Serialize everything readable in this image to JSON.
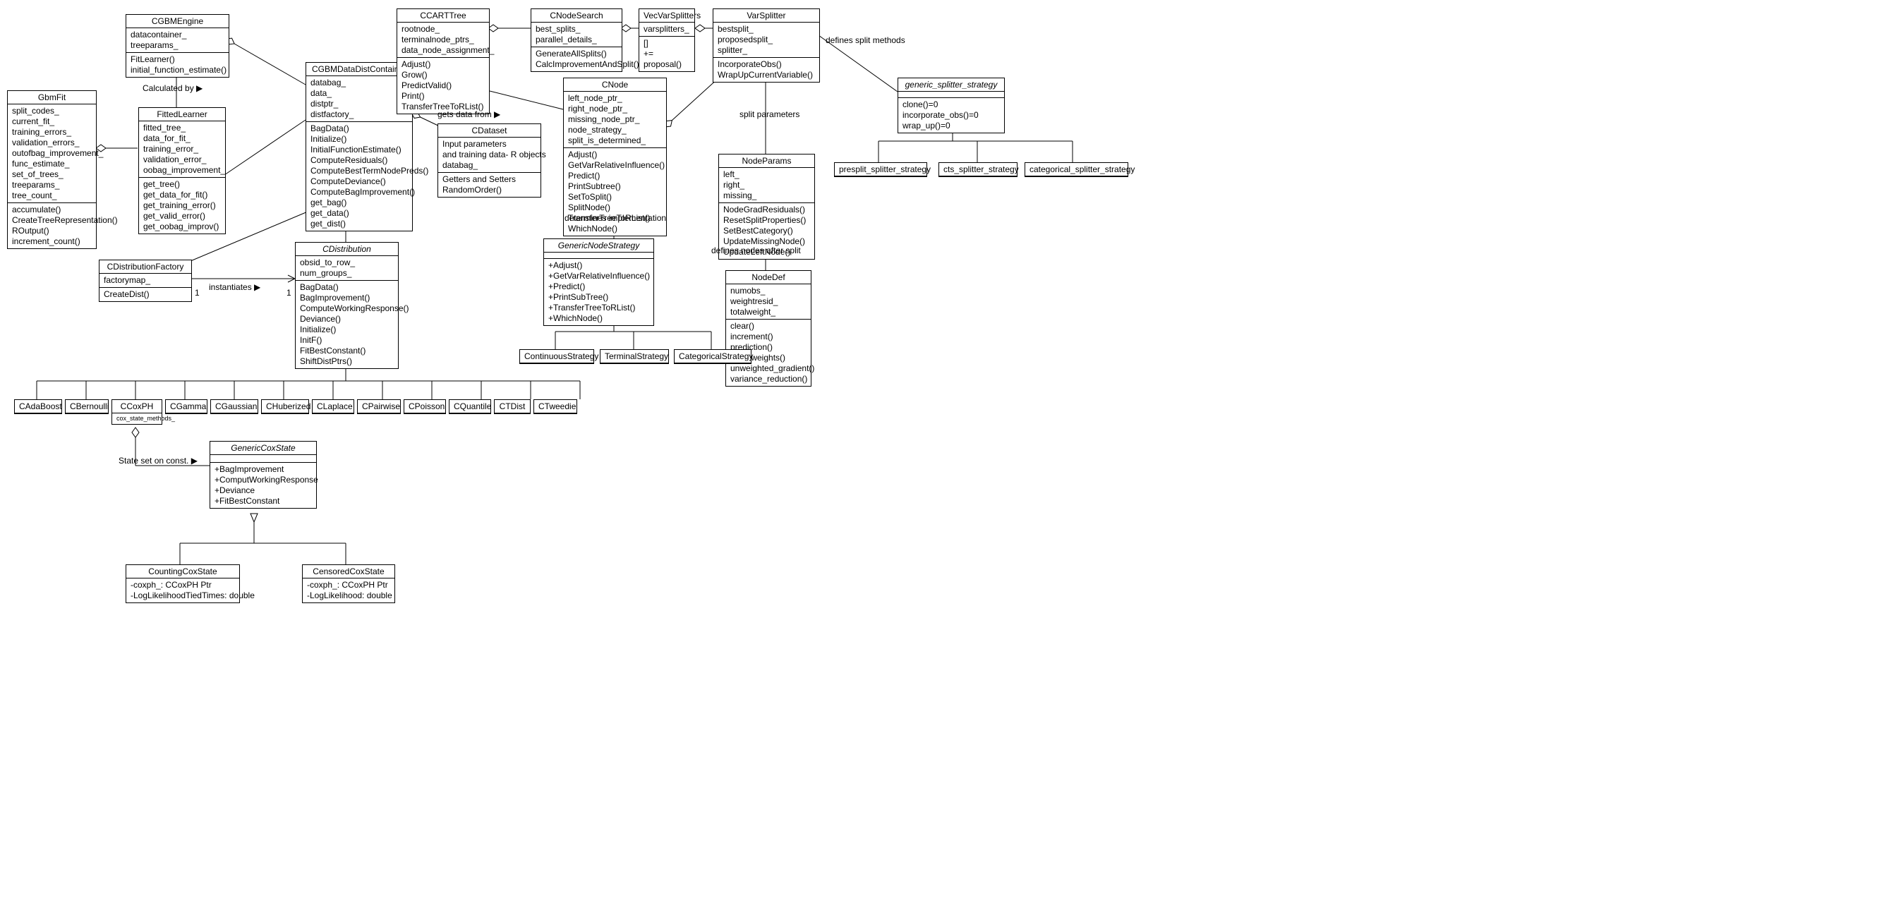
{
  "classes": {
    "CGBMEngine": {
      "name": "CGBMEngine",
      "attrs": "datacontainer_\ntreeparams_",
      "ops": "FitLearner()\ninitial_function_estimate()"
    },
    "GbmFit": {
      "name": "GbmFit",
      "attrs": "split_codes_\ncurrent_fit_\ntraining_errors_\nvalidation_errors_\noutofbag_improvement_\nfunc_estimate_\nset_of_trees_\ntreeparams_\ntree_count_",
      "ops": "accumulate()\nCreateTreeRepresentation()\nROutput()\nincrement_count()"
    },
    "FittedLearner": {
      "name": "FittedLearner",
      "attrs": "fitted_tree_\ndata_for_fit_\ntraining_error_\nvalidation_error_\noobag_improvement_",
      "ops": "get_tree()\nget_data_for_fit()\nget_training_error()\nget_valid_error()\nget_oobag_improv()"
    },
    "CDistributionFactory": {
      "name": "CDistributionFactory",
      "attrs": "factorymap_",
      "ops": "CreateDist()"
    },
    "CGBMDataDistContainer": {
      "name": "CGBMDataDistContainer",
      "attrs": "databag_\ndata_\ndistptr_\ndistfactory_",
      "ops": "BagData()\nInitialize()\nInitialFunctionEstimate()\nComputeResiduals()\nComputeBestTermNodePreds()\nComputeDeviance()\nComputeBagImprovement()\nget_bag()\nget_data()\nget_dist()"
    },
    "CDistribution": {
      "name": "CDistribution",
      "italic": true,
      "attrs": "obsid_to_row_\nnum_groups_",
      "ops": "BagData()\nBagImprovement()\nComputeWorkingResponse()\nDeviance()\nInitialize()\nInitF()\nFitBestConstant()\nShiftDistPtrs()"
    },
    "CDataset": {
      "name": "CDataset",
      "attrs": "Input parameters\nand training data- R objects\ndatabag_",
      "ops": "Getters and Setters\nRandomOrder()"
    },
    "CCARTTree": {
      "name": "CCARTTree",
      "attrs": "rootnode_\nterminalnode_ptrs_\ndata_node_assignment_",
      "ops": "Adjust()\nGrow()\nPredictValid()\nPrint()\nTransferTreeToRList()"
    },
    "CNodeSearch": {
      "name": "CNodeSearch",
      "attrs": "best_splits_\nparallel_details_",
      "ops": "GenerateAllSplits()\nCalcImprovementAndSplit()"
    },
    "VecVarSplitters": {
      "name": "VecVarSplitters",
      "attrs": "varsplitters_",
      "ops": "[]\n+=\nproposal()"
    },
    "VarSplitter": {
      "name": "VarSplitter",
      "attrs": "bestsplit_\nproposedsplit_\nsplitter_",
      "ops": "IncorporateObs()\nWrapUpCurrentVariable()"
    },
    "CNode": {
      "name": "CNode",
      "attrs": "left_node_ptr_\nright_node_ptr_\nmissing_node_ptr_\nnode_strategy_\nsplit_is_determined_",
      "ops": "Adjust()\nGetVarRelativeInfluence()\nPredict()\nPrintSubtree()\nSetToSplit()\nSplitNode()\nTransferTreeToRList()\nWhichNode()"
    },
    "GenericNodeStrategy": {
      "name": "GenericNodeStrategy",
      "italic": true,
      "ops": "+Adjust()\n+GetVarRelativeInfluence()\n+Predict()\n+PrintSubTree()\n+TransferTreeToRList()\n+WhichNode()"
    },
    "NodeParams": {
      "name": "NodeParams",
      "attrs": "left_\nright_\nmissing_",
      "ops": "NodeGradResiduals()\nResetSplitProperties()\nSetBestCategory()\nUpdateMissingNode()\nUpdateLeftNode()"
    },
    "NodeDef": {
      "name": "NodeDef",
      "attrs": "numobs_\nweightresid_\ntotalweight_",
      "ops": "clear()\nincrement()\nprediction()\nsum_weights()\nunweighted_gradient()\nvariance_reduction()"
    },
    "generic_splitter_strategy": {
      "name": "generic_splitter_strategy",
      "italic": true,
      "ops": "clone()=0\nincorporate_obs()=0\nwrap_up()=0"
    },
    "presplit": {
      "name": "presplit_splitter_strategy"
    },
    "cts": {
      "name": "cts_splitter_strategy"
    },
    "categorical_splitter": {
      "name": "categorical_splitter_strategy"
    },
    "ContinuousStrategy": {
      "name": "ContinuousStrategy"
    },
    "TerminalStrategy": {
      "name": "TerminalStrategy"
    },
    "CategoricalStrategy": {
      "name": "CategoricalStrategy"
    },
    "CAdaBoost": {
      "name": "CAdaBoost"
    },
    "CBernoulli": {
      "name": "CBernoulli"
    },
    "CCoxPH": {
      "name": "CCoxPH",
      "attrs": "cox_state_methods_"
    },
    "CGamma": {
      "name": "CGamma"
    },
    "CGaussian": {
      "name": "CGaussian"
    },
    "CHuberized": {
      "name": "CHuberized"
    },
    "CLaplace": {
      "name": "CLaplace"
    },
    "CPairwise": {
      "name": "CPairwise"
    },
    "CPoisson": {
      "name": "CPoisson"
    },
    "CQuantile": {
      "name": "CQuantile"
    },
    "CTDist": {
      "name": "CTDist"
    },
    "CTweedie": {
      "name": "CTweedie"
    },
    "GenericCoxState": {
      "name": "GenericCoxState",
      "italic": true,
      "ops": "+BagImprovement\n+ComputWorkingResponse\n+Deviance\n+FitBestConstant"
    },
    "CountingCoxState": {
      "name": "CountingCoxState",
      "attrs": "-coxph_: CCoxPH Ptr\n-LogLikelihoodTiedTimes: double"
    },
    "CensoredCoxState": {
      "name": "CensoredCoxState",
      "attrs": "-coxph_: CCoxPH Ptr\n-LogLikelihood: double"
    }
  },
  "labels": {
    "calculated_by": "Calculated by ▶",
    "instantiates": "instantiates ▶",
    "gets_data": "gets data from ▶",
    "determines_impl": "determines implementation",
    "split_params": "split parameters",
    "defines_nodes": "defines nodes after split",
    "defines_split": "defines split methods",
    "state_set": "State set on const. ▶",
    "one": "1"
  },
  "chart_data": {
    "type": "uml-class-diagram",
    "relationships": [
      {
        "from": "GbmFit",
        "to": "FittedLearner",
        "kind": "aggregation"
      },
      {
        "from": "CGBMEngine",
        "to": "CGBMDataDistContainer",
        "kind": "aggregation"
      },
      {
        "from": "CGBMEngine",
        "to": "FittedLearner",
        "kind": "association",
        "label": "Calculated by"
      },
      {
        "from": "FittedLearner",
        "to": "CGBMDataDistContainer",
        "kind": "association"
      },
      {
        "from": "CDistributionFactory",
        "to": "CDistribution",
        "kind": "association",
        "label": "instantiates",
        "mult": "1..1"
      },
      {
        "from": "CGBMDataDistContainer",
        "to": "CDistributionFactory",
        "kind": "aggregation"
      },
      {
        "from": "CGBMDataDistContainer",
        "to": "CDistribution",
        "kind": "aggregation"
      },
      {
        "from": "CGBMDataDistContainer",
        "to": "CDataset",
        "kind": "aggregation",
        "label": "gets data from"
      },
      {
        "from": "CGBMDataDistContainer",
        "to": "CCARTTree",
        "kind": "association"
      },
      {
        "from": "CCARTTree",
        "to": "CNodeSearch",
        "kind": "aggregation"
      },
      {
        "from": "CCARTTree",
        "to": "CNode",
        "kind": "aggregation"
      },
      {
        "from": "CNodeSearch",
        "to": "VecVarSplitters",
        "kind": "aggregation"
      },
      {
        "from": "VecVarSplitters",
        "to": "VarSplitter",
        "kind": "aggregation"
      },
      {
        "from": "CNode",
        "to": "VarSplitter",
        "kind": "aggregation"
      },
      {
        "from": "CNode",
        "to": "GenericNodeStrategy",
        "kind": "association",
        "label": "determines implementation"
      },
      {
        "from": "VarSplitter",
        "to": "NodeParams",
        "kind": "aggregation",
        "label": "split parameters"
      },
      {
        "from": "NodeParams",
        "to": "NodeDef",
        "kind": "aggregation",
        "label": "defines nodes after split"
      },
      {
        "from": "VarSplitter",
        "to": "generic_splitter_strategy",
        "kind": "association",
        "label": "defines split methods"
      },
      {
        "from": "ContinuousStrategy",
        "to": "GenericNodeStrategy",
        "kind": "generalization"
      },
      {
        "from": "TerminalStrategy",
        "to": "GenericNodeStrategy",
        "kind": "generalization"
      },
      {
        "from": "CategoricalStrategy",
        "to": "GenericNodeStrategy",
        "kind": "generalization"
      },
      {
        "from": "presplit_splitter_strategy",
        "to": "generic_splitter_strategy",
        "kind": "generalization"
      },
      {
        "from": "cts_splitter_strategy",
        "to": "generic_splitter_strategy",
        "kind": "generalization"
      },
      {
        "from": "categorical_splitter_strategy",
        "to": "generic_splitter_strategy",
        "kind": "generalization"
      },
      {
        "from": "CAdaBoost",
        "to": "CDistribution",
        "kind": "generalization"
      },
      {
        "from": "CBernoulli",
        "to": "CDistribution",
        "kind": "generalization"
      },
      {
        "from": "CCoxPH",
        "to": "CDistribution",
        "kind": "generalization"
      },
      {
        "from": "CGamma",
        "to": "CDistribution",
        "kind": "generalization"
      },
      {
        "from": "CGaussian",
        "to": "CDistribution",
        "kind": "generalization"
      },
      {
        "from": "CHuberized",
        "to": "CDistribution",
        "kind": "generalization"
      },
      {
        "from": "CLaplace",
        "to": "CDistribution",
        "kind": "generalization"
      },
      {
        "from": "CPairwise",
        "to": "CDistribution",
        "kind": "generalization"
      },
      {
        "from": "CPoisson",
        "to": "CDistribution",
        "kind": "generalization"
      },
      {
        "from": "CQuantile",
        "to": "CDistribution",
        "kind": "generalization"
      },
      {
        "from": "CTDist",
        "to": "CDistribution",
        "kind": "generalization"
      },
      {
        "from": "CTweedie",
        "to": "CDistribution",
        "kind": "generalization"
      },
      {
        "from": "CCoxPH",
        "to": "GenericCoxState",
        "kind": "aggregation",
        "label": "State set on const."
      },
      {
        "from": "CountingCoxState",
        "to": "GenericCoxState",
        "kind": "generalization"
      },
      {
        "from": "CensoredCoxState",
        "to": "GenericCoxState",
        "kind": "generalization"
      }
    ]
  }
}
